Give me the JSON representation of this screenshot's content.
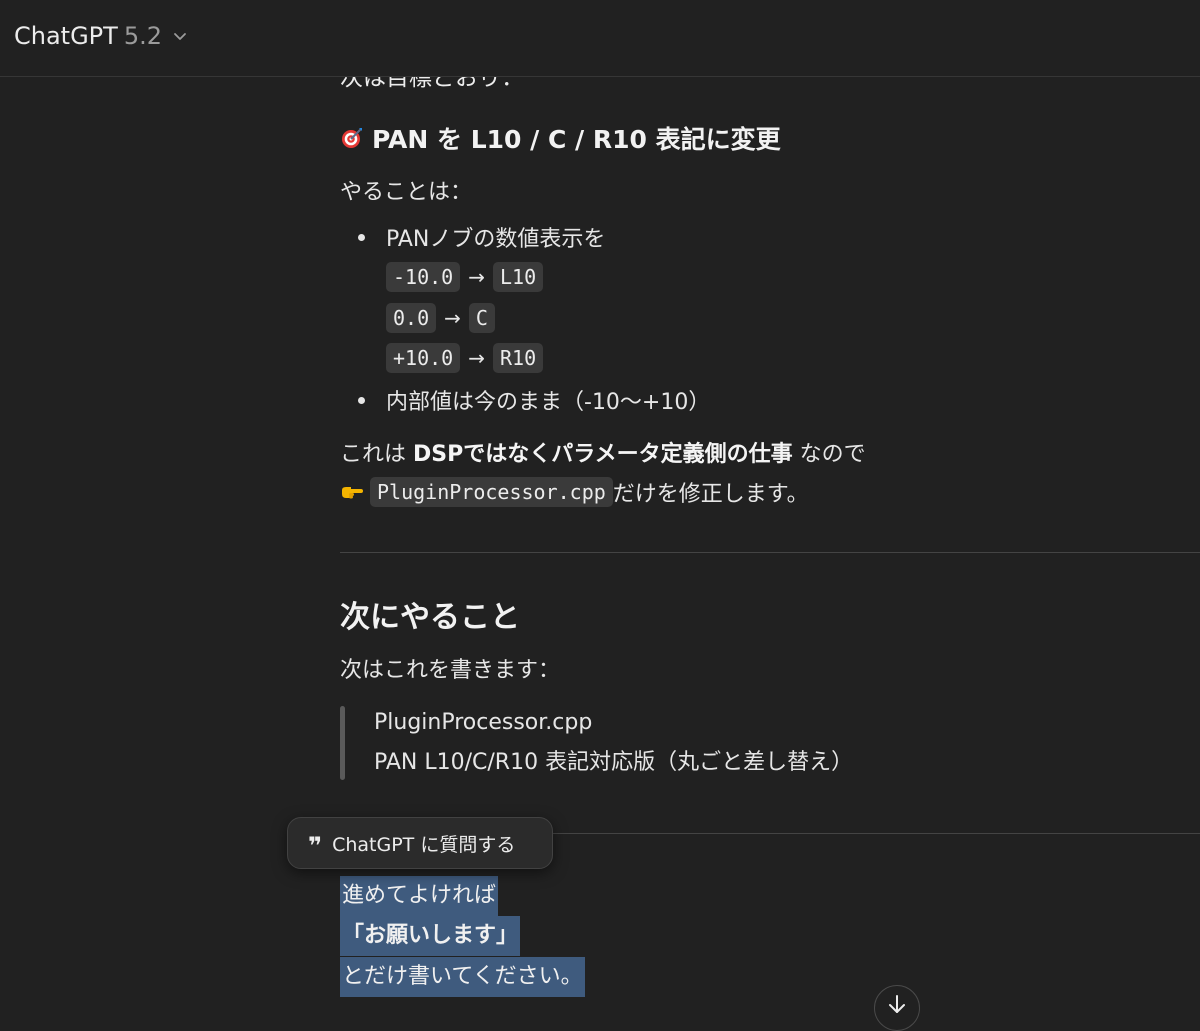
{
  "header": {
    "model_name": "ChatGPT",
    "model_version": "5.2",
    "chevron_icon": "chevron-down-icon"
  },
  "message": {
    "clipped_line": "次は目標どおり：",
    "target_heading": {
      "icon": "dart-target-icon",
      "text": "PAN を L10 / C / R10 表記に変更"
    },
    "todo_label": "やることは：",
    "bullets": [
      {
        "text": "PANノブの数値表示を",
        "mappings": [
          {
            "from": "-10.0",
            "arrow": "→",
            "to": "L10"
          },
          {
            "from": "0.0",
            "arrow": "→",
            "to": "C"
          },
          {
            "from": "+10.0",
            "arrow": "→",
            "to": "R10"
          }
        ]
      },
      {
        "text": "内部値は今のまま（-10〜+10）"
      }
    ],
    "note_line1_prefix": "これは ",
    "note_line1_bold": "DSPではなくパラメータ定義側の仕事",
    "note_line1_suffix": " なので",
    "note_line2_hand_icon": "pointing-hand-icon",
    "note_line2_code": "PluginProcessor.cpp",
    "note_line2_suffix": " だけを修正します。",
    "next_heading": "次にやること",
    "next_intro": "次はこれを書きます：",
    "quote_lines": [
      "PluginProcessor.cpp",
      "PAN L10/C/R10 表記対応版（丸ごと差し替え）"
    ],
    "selected_lines": {
      "line1": "進めてよければ",
      "line2": "「お願いします」",
      "line3": "とだけ書いてください。"
    }
  },
  "popup": {
    "icon": "quote-icon",
    "label": "ChatGPT に質問する"
  },
  "scroll_button": {
    "icon": "arrow-down-icon"
  }
}
